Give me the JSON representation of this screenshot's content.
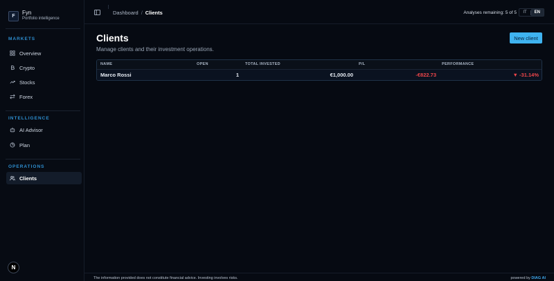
{
  "brand": {
    "logo_letter": "F",
    "name": "Fyn",
    "subtitle": "Portfolio intelligence"
  },
  "sidebar": {
    "sections": [
      {
        "title": "MARKETS",
        "items": [
          {
            "label": "Overview",
            "icon": "grid-icon"
          },
          {
            "label": "Crypto",
            "icon": "bitcoin-icon"
          },
          {
            "label": "Stocks",
            "icon": "trend-icon"
          },
          {
            "label": "Forex",
            "icon": "swap-icon"
          }
        ]
      },
      {
        "title": "INTELLIGENCE",
        "items": [
          {
            "label": "AI Advisor",
            "icon": "bot-icon"
          },
          {
            "label": "Plan",
            "icon": "pie-icon"
          }
        ]
      },
      {
        "title": "OPERATIONS",
        "items": [
          {
            "label": "Clients",
            "icon": "users-icon",
            "active": true
          }
        ]
      }
    ],
    "bottom_logo": "N"
  },
  "topbar": {
    "breadcrumb": [
      "Dashboard",
      "Clients"
    ],
    "breadcrumb_sep": "/",
    "analyses_remaining": "Analyses remaining: 5 of 5",
    "languages": [
      "IT",
      "EN"
    ],
    "active_language": "EN"
  },
  "page": {
    "title": "Clients",
    "description": "Manage clients and their investment operations.",
    "new_button": "New client"
  },
  "table": {
    "columns": [
      "NAME",
      "OPEN",
      "TOTAL INVESTED",
      "P/L",
      "PERFORMANCE"
    ],
    "rows": [
      {
        "name": "Marco Rossi",
        "open": "1",
        "total_invested": "€1,000.00",
        "pl": "-€822.73",
        "performance": "▼ -31.14%"
      }
    ]
  },
  "footer": {
    "disclaimer": "The information provided does not constitute financial advice. Investing involves risks.",
    "powered_prefix": "powered by",
    "powered_brand": "DIAG AI"
  },
  "colors": {
    "accent": "#3fb3f0",
    "negative": "#f0464a",
    "section": "#2e8fd1"
  }
}
